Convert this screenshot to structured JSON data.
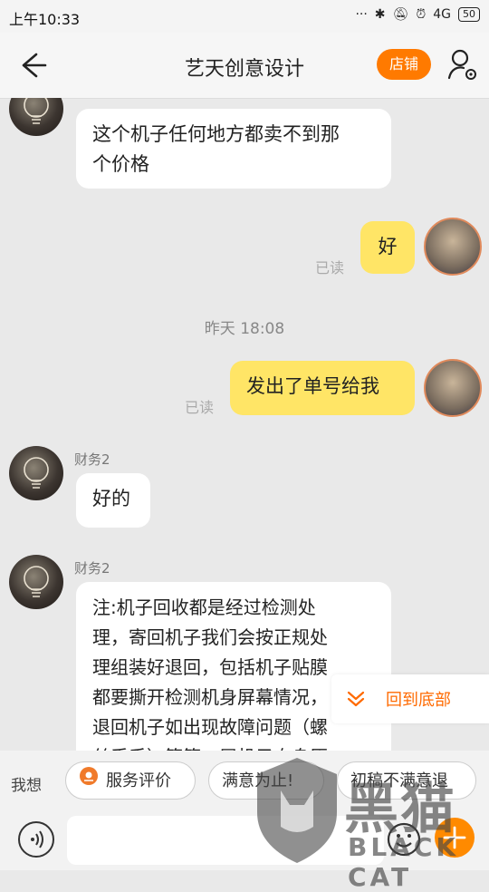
{
  "status_bar": {
    "time": "上午10:33",
    "signal": "4G",
    "battery": "50"
  },
  "header": {
    "title": "艺天创意设计",
    "shop_button": "店铺"
  },
  "chat": {
    "messages": [
      {
        "text1": "这个机子任何地方都卖不到那",
        "text2": "个价格"
      },
      {
        "text": "好",
        "read": "已读"
      },
      {
        "timestamp": "昨天  18:08"
      },
      {
        "text": "发出了单号给我",
        "read": "已读"
      },
      {
        "sender": "财务2",
        "text": "好的"
      },
      {
        "sender": "财务2",
        "lines": [
          "注:机子回收都是经过检测处",
          "理，寄回机子我们会按正规处",
          "理组装好退回，包括机子贴膜",
          "都要撕开检测机身屏幕情况，",
          "退回机子如出现故障问题（螺",
          "丝丢手）等等，屈机子自身原"
        ]
      }
    ],
    "scroll_to_bottom": "回到底部"
  },
  "quick_replies": {
    "lead": "我想",
    "chips": [
      "服务评价",
      "满意为止!",
      "初稿不满意退"
    ]
  },
  "watermark": {
    "cn": "黑猫",
    "en": "BLACK CAT"
  }
}
